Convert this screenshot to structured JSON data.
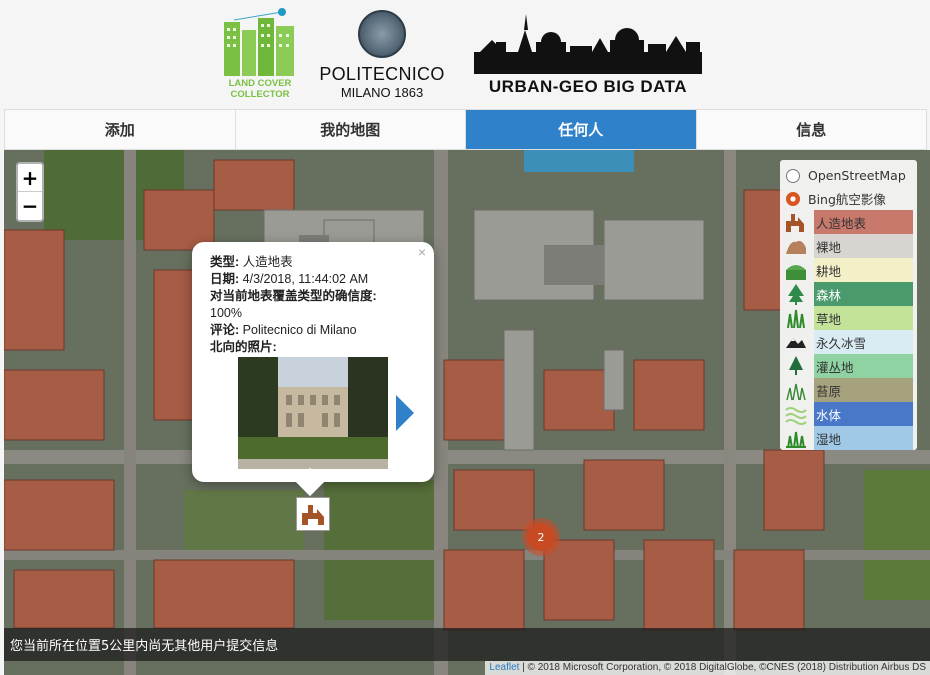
{
  "header": {
    "lcc_logo_text": "LAND COVER COLLECTOR",
    "polimi_name": "POLITECNICO",
    "polimi_city": "MILANO 1863",
    "ugbd_title": "URBAN-GEO BIG DATA"
  },
  "tabs": [
    {
      "label": "添加",
      "active": false
    },
    {
      "label": "我的地图",
      "active": false
    },
    {
      "label": "任何人",
      "active": true
    },
    {
      "label": "信息",
      "active": false
    }
  ],
  "map": {
    "zoom_in": "+",
    "zoom_out": "−",
    "base_layers": [
      {
        "label": "OpenStreetMap",
        "selected": false
      },
      {
        "label": "Bing航空影像",
        "selected": true
      }
    ],
    "overlays": [
      {
        "label": "人造地表",
        "color": "#c8796b",
        "icon": "building-icon"
      },
      {
        "label": "裸地",
        "color": "#d8d4d0",
        "icon": "bare-ground-icon"
      },
      {
        "label": "耕地",
        "color": "#f3efc7",
        "icon": "cropland-icon"
      },
      {
        "label": "森林",
        "color": "#4a9a6e",
        "icon": "forest-icon"
      },
      {
        "label": "草地",
        "color": "#c3e29a",
        "icon": "grassland-icon"
      },
      {
        "label": "永久冰雪",
        "color": "#d9ecf4",
        "icon": "snow-icon"
      },
      {
        "label": "灌丛地",
        "color": "#8fd3a3",
        "icon": "shrub-icon"
      },
      {
        "label": "苔原",
        "color": "#a6a27d",
        "icon": "tundra-icon"
      },
      {
        "label": "水体",
        "color": "#4a78c9",
        "icon": "water-icon"
      },
      {
        "label": "湿地",
        "color": "#9fc9e6",
        "icon": "wetland-icon"
      }
    ],
    "popup": {
      "type_label": "类型:",
      "type_value": "人造地表",
      "date_label": "日期:",
      "date_value": "4/3/2018, 11:44:02 AM",
      "confidence_label": "对当前地表覆盖类型的确信度:",
      "confidence_value": "100%",
      "comment_label": "评论:",
      "comment_value": "Politecnico di Milano",
      "photo_label": "北向的照片:",
      "close": "×"
    },
    "cluster_count": "2",
    "status_text": "您当前所在位置5公里内尚无其他用户提交信息",
    "attribution_link": "Leaflet",
    "attribution_text": " | © 2018 Microsoft Corporation, © 2018 DigitalGlobe, ©CNES (2018) Distribution Airbus DS"
  }
}
